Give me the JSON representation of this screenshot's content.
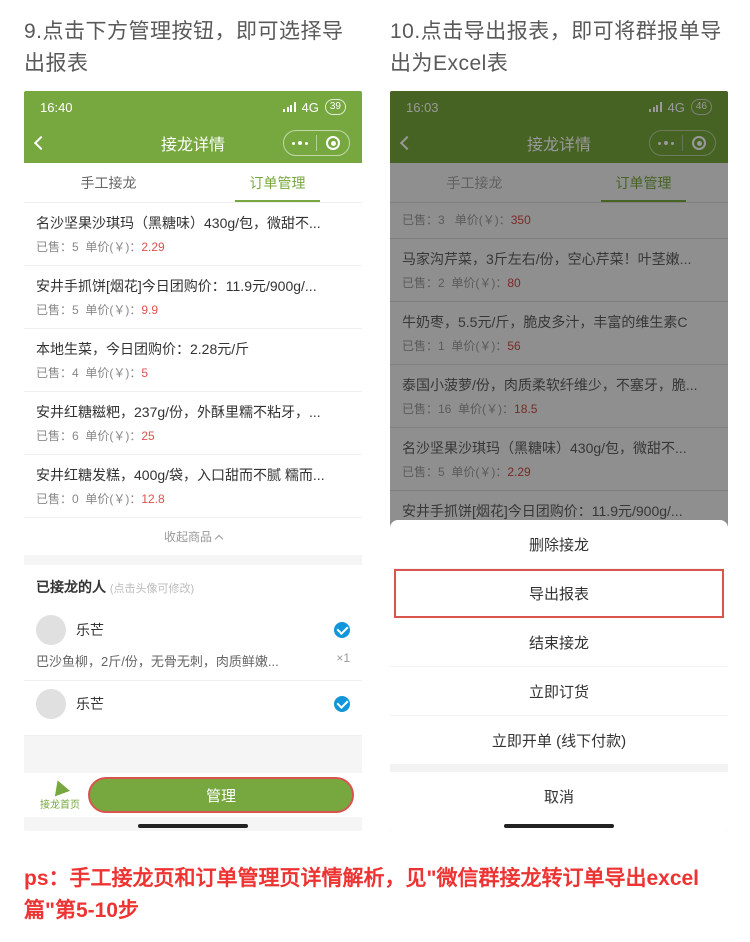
{
  "steps": {
    "left": {
      "num": "9.",
      "text": "点击下方管理按钮，即可选择导出报表"
    },
    "right": {
      "num": "10.",
      "text": "点击导出报表，即可将群报单导出为Excel表"
    }
  },
  "left_phone": {
    "time": "16:40",
    "network": "4G",
    "battery": "39",
    "header_title": "接龙详情",
    "tabs": {
      "manual": "手工接龙",
      "orders": "订单管理"
    },
    "products": [
      {
        "title": "名沙坚果沙琪玛（黑糖味）430g/包，微甜不...",
        "sold": "5",
        "price": "2.29"
      },
      {
        "title": "安井手抓饼[烟花]今日团购价：11.9元/900g/...",
        "sold": "5",
        "price": "9.9"
      },
      {
        "title": "本地生菜，今日团购价：2.28元/斤",
        "sold": "4",
        "price": "5"
      },
      {
        "title": "安井红糖糍粑，237g/份，外酥里糯不粘牙，...",
        "sold": "6",
        "price": "25"
      },
      {
        "title": "安井红糖发糕，400g/袋，入口甜而不腻 糯而...",
        "sold": "0",
        "price": "12.8"
      }
    ],
    "meta_sold_label": "已售：",
    "meta_price_label": "单价(￥)：",
    "collapse_label": "收起商品",
    "people_header": "已接龙的人",
    "people_hint": "(点击头像可修改)",
    "people": [
      {
        "name": "乐芒",
        "detail": "巴沙鱼柳，2斤/份，无骨无刺，肉质鲜嫩...",
        "qty": "×1"
      },
      {
        "name": "乐芒",
        "detail": "",
        "qty": ""
      }
    ],
    "home_label": "接龙首页",
    "manage_label": "管理"
  },
  "right_phone": {
    "time": "16:03",
    "network": "4G",
    "battery": "46",
    "header_title": "接龙详情",
    "tabs": {
      "manual": "手工接龙",
      "orders": "订单管理"
    },
    "top_partial": {
      "sold": "3",
      "price": "350"
    },
    "products": [
      {
        "title": "马家沟芹菜，3斤左右/份，空心芹菜！叶茎嫩...",
        "sold": "2",
        "price": "80"
      },
      {
        "title": "牛奶枣，5.5元/斤，脆皮多汁，丰富的维生素C",
        "sold": "1",
        "price": "56"
      },
      {
        "title": "泰国小菠萝/份，肉质柔软纤维少，不塞牙，脆...",
        "sold": "16",
        "price": "18.5"
      },
      {
        "title": "名沙坚果沙琪玛（黑糖味）430g/包，微甜不...",
        "sold": "5",
        "price": "2.29"
      },
      {
        "title": "安井手抓饼[烟花]今日团购价：11.9元/900g/...",
        "sold": "",
        "price": ""
      }
    ],
    "meta_sold_label": "已售：",
    "meta_price_label": "单价(￥)：",
    "sheet": {
      "delete": "删除接龙",
      "export": "导出报表",
      "end": "结束接龙",
      "order_now": "立即订货",
      "open_offline": "立即开单 (线下付款)",
      "cancel": "取消"
    }
  },
  "footnote": "ps：手工接龙页和订单管理页详情解析，见\"微信群接龙转订单导出excel篇\"第5-10步"
}
